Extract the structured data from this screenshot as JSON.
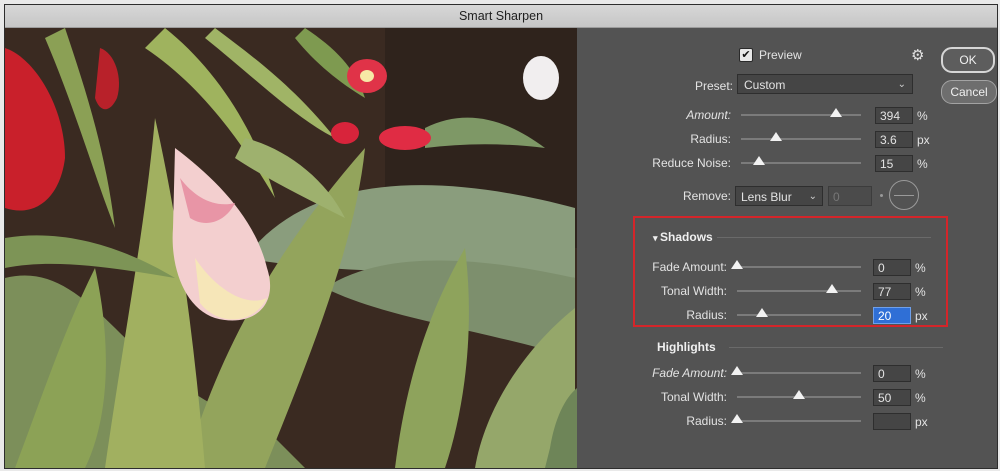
{
  "window": {
    "title": "Smart Sharpen"
  },
  "preview": {
    "label": "Preview",
    "checked": "✔"
  },
  "buttons": {
    "ok": "OK",
    "cancel": "Cancel"
  },
  "preset": {
    "label": "Preset:",
    "value": "Custom"
  },
  "sharpen": {
    "amount": {
      "label": "Amount:",
      "value": "394",
      "unit": "%",
      "level": 0.79
    },
    "radius": {
      "label": "Radius:",
      "value": "3.6",
      "unit": "px",
      "level": 0.29
    },
    "noise": {
      "label": "Reduce Noise:",
      "value": "15",
      "unit": "%",
      "level": 0.15
    }
  },
  "remove": {
    "label": "Remove:",
    "value": "Lens Blur",
    "angle": "0",
    "degree": "°"
  },
  "shadows": {
    "heading": "Shadows",
    "fade": {
      "label": "Fade Amount:",
      "value": "0",
      "unit": "%",
      "level": 0.0
    },
    "tonal": {
      "label": "Tonal Width:",
      "value": "77",
      "unit": "%",
      "level": 0.77
    },
    "radius": {
      "label": "Radius:",
      "value": "20",
      "unit": "px",
      "level": 0.2
    }
  },
  "highlights": {
    "heading": "Highlights",
    "fade": {
      "label": "Fade Amount:",
      "value": "0",
      "unit": "%",
      "level": 0.0
    },
    "tonal": {
      "label": "Tonal Width:",
      "value": "50",
      "unit": "%",
      "level": 0.5
    },
    "radius": {
      "label": "Radius:",
      "value": "",
      "unit": "px",
      "level": 0.0
    }
  },
  "icons": {
    "gear": "gear-icon",
    "chevron": "chevron-down-icon",
    "disclosure": "disclosure-triangle-icon"
  },
  "colors": {
    "highlight_box": "#d4252a",
    "active_field": "#2f6fd6"
  }
}
